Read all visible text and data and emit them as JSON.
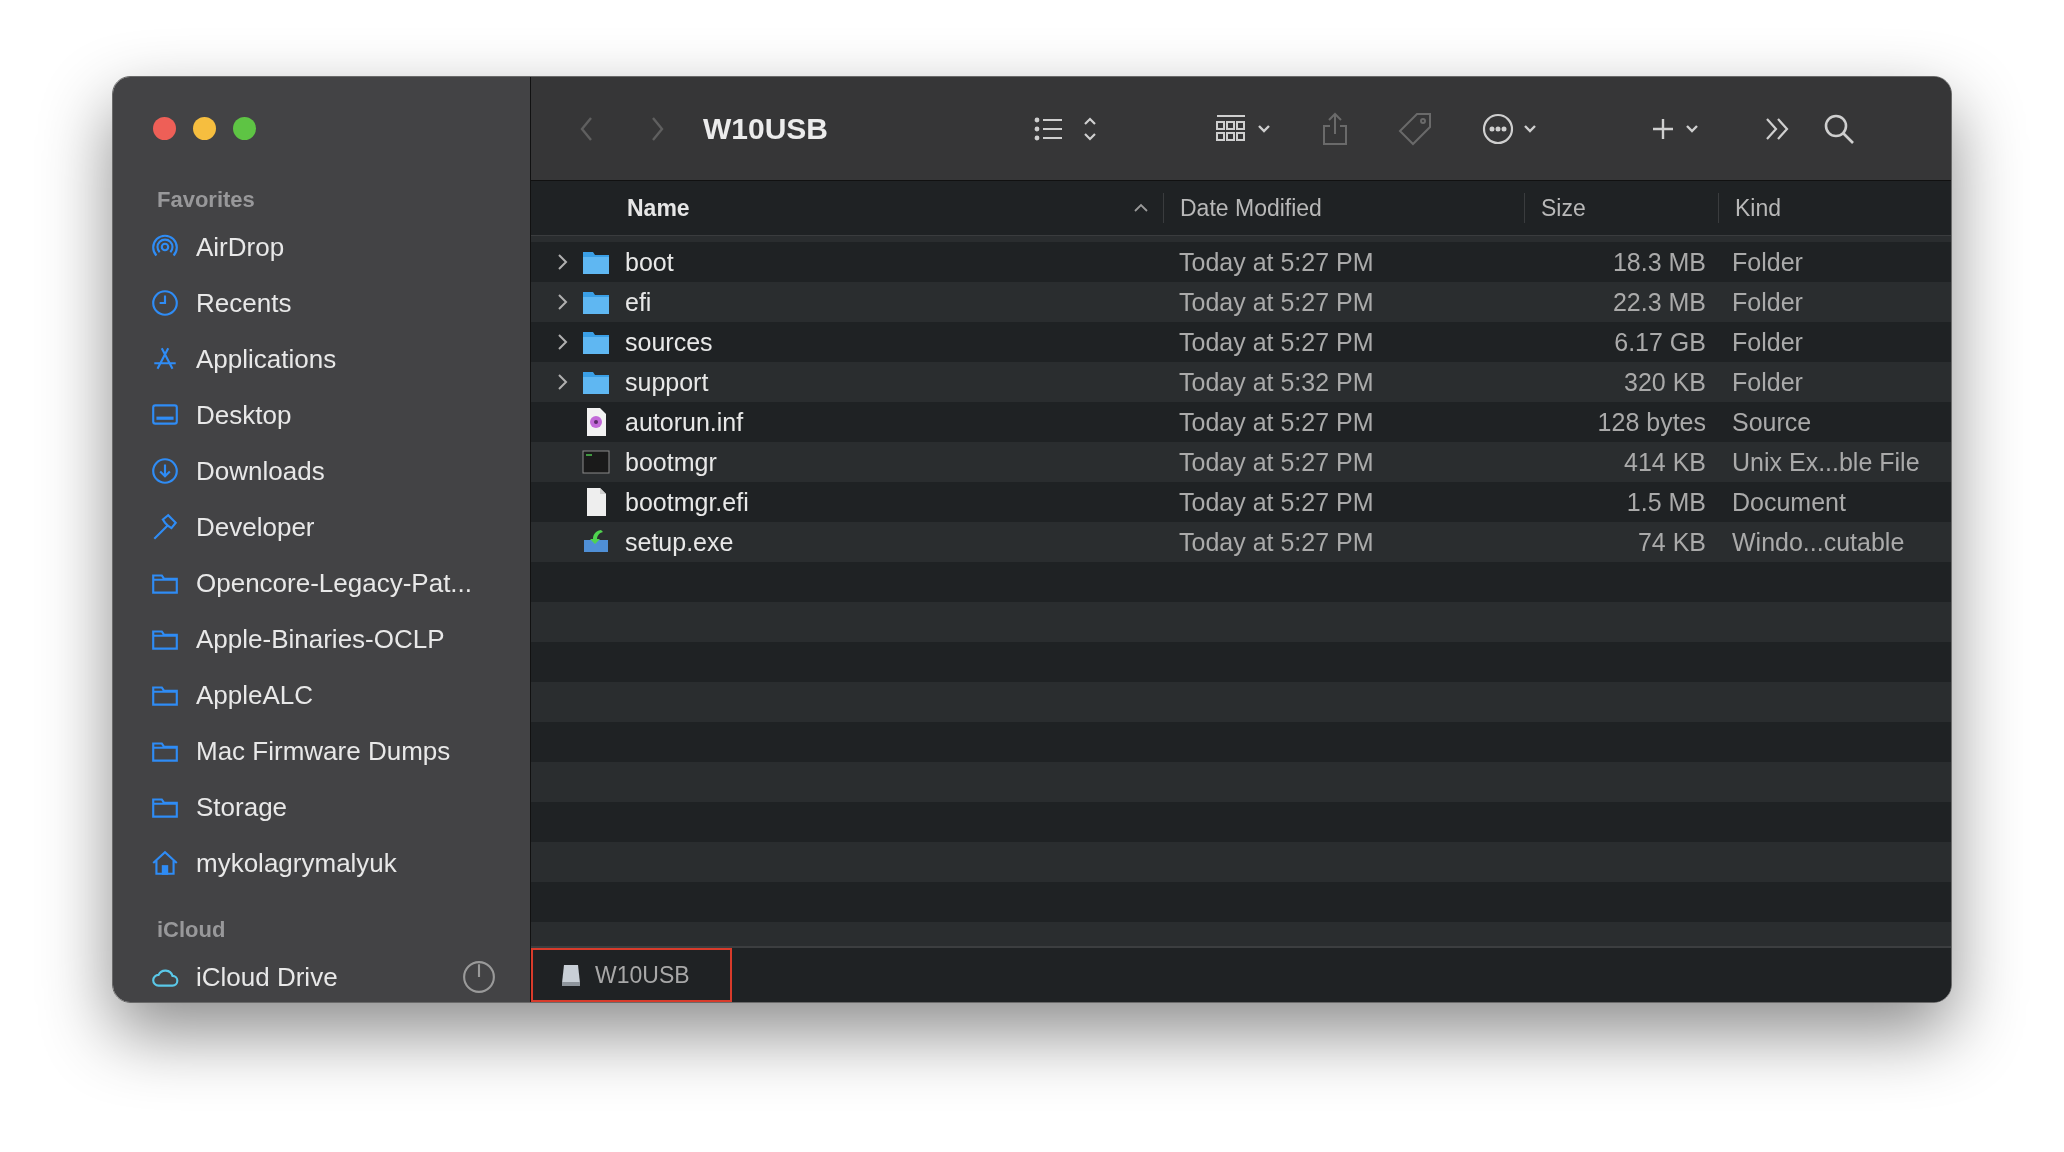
{
  "window": {
    "title": "W10USB"
  },
  "toolbar": {
    "nav": [
      {
        "kind": "back",
        "disabled": true
      },
      {
        "kind": "forward",
        "disabled": true
      }
    ],
    "tools": [
      {
        "kind": "list-view"
      },
      {
        "kind": "grid-view"
      },
      {
        "kind": "share"
      },
      {
        "kind": "tag"
      },
      {
        "kind": "more"
      },
      {
        "kind": "new"
      },
      {
        "kind": "overflow"
      },
      {
        "kind": "search"
      }
    ]
  },
  "sidebar": {
    "sections": [
      {
        "title": "Favorites",
        "items": [
          {
            "label": "AirDrop",
            "kind": "airdrop"
          },
          {
            "label": "Recents",
            "kind": "recents"
          },
          {
            "label": "Applications",
            "kind": "applications"
          },
          {
            "label": "Desktop",
            "kind": "desktop"
          },
          {
            "label": "Downloads",
            "kind": "downloads"
          },
          {
            "label": "Developer",
            "kind": "developer"
          },
          {
            "label": "Opencore-Legacy-Pat...",
            "kind": "folder"
          },
          {
            "label": "Apple-Binaries-OCLP",
            "kind": "folder"
          },
          {
            "label": "AppleALC",
            "kind": "folder"
          },
          {
            "label": "Mac Firmware Dumps",
            "kind": "folder"
          },
          {
            "label": "Storage",
            "kind": "folder"
          },
          {
            "label": "mykolagrymalyuk",
            "kind": "home"
          }
        ]
      },
      {
        "title": "iCloud",
        "items": [
          {
            "label": "iCloud Drive",
            "kind": "cloud"
          }
        ]
      }
    ]
  },
  "table": {
    "columns": [
      {
        "label": "Name",
        "sorted": true
      },
      {
        "label": "Date Modified",
        "sorted": false
      },
      {
        "label": "Size",
        "sorted": false
      },
      {
        "label": "Kind",
        "sorted": false
      }
    ],
    "rows": [
      {
        "name": "boot",
        "kind": "folder",
        "date": "Today at 5:27 PM",
        "size": "18.3 MB",
        "type": "Folder"
      },
      {
        "name": "efi",
        "kind": "folder",
        "date": "Today at 5:27 PM",
        "size": "22.3 MB",
        "type": "Folder"
      },
      {
        "name": "sources",
        "kind": "folder",
        "date": "Today at 5:27 PM",
        "size": "6.17 GB",
        "type": "Folder"
      },
      {
        "name": "support",
        "kind": "folder",
        "date": "Today at 5:32 PM",
        "size": "320 KB",
        "type": "Folder"
      },
      {
        "name": "autorun.inf",
        "kind": "source",
        "date": "Today at 5:27 PM",
        "size": "128 bytes",
        "type": "Source"
      },
      {
        "name": "bootmgr",
        "kind": "executable",
        "date": "Today at 5:27 PM",
        "size": "414 KB",
        "type": "Unix Ex...ble File"
      },
      {
        "name": "bootmgr.efi",
        "kind": "document",
        "date": "Today at 5:27 PM",
        "size": "1.5 MB",
        "type": "Document"
      },
      {
        "name": "setup.exe",
        "kind": "installer",
        "date": "Today at 5:27 PM",
        "size": "74 KB",
        "type": "Windo...cutable"
      }
    ]
  },
  "path_bar": [
    {
      "label": "W10USB",
      "highlighted": true
    }
  ]
}
